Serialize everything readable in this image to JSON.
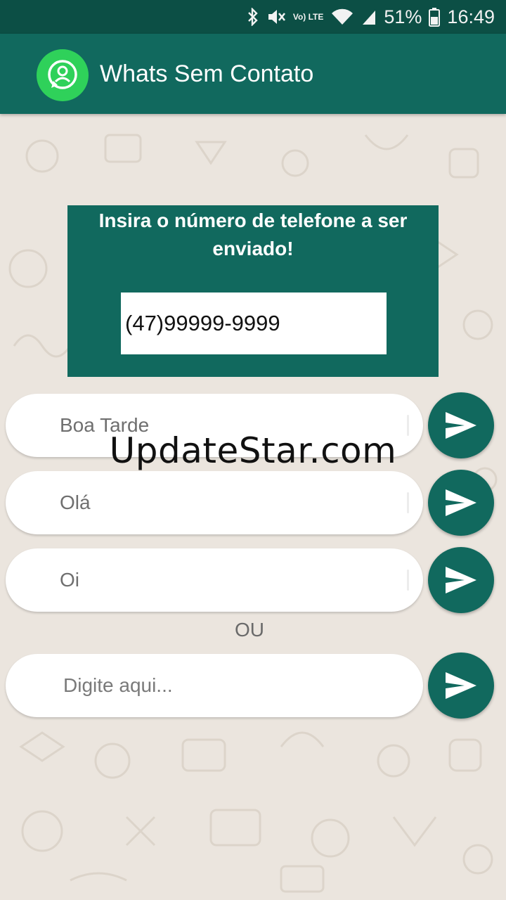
{
  "status_bar": {
    "battery_percent": "51%",
    "time": "16:49",
    "network_label": "Vo) LTE"
  },
  "app_bar": {
    "title": "Whats Sem Contato"
  },
  "phone_card": {
    "title": "Insira o número de telefone a ser enviado!",
    "phone_value": "(47)99999-9999"
  },
  "messages": [
    {
      "text": "Boa Tarde"
    },
    {
      "text": "Olá"
    },
    {
      "text": "Oi"
    }
  ],
  "separator": "OU",
  "custom_message": {
    "placeholder": "Digite aqui..."
  },
  "watermark": "UpdateStar.com",
  "colors": {
    "status_bar": "#0c4f45",
    "app_bar": "#11695e",
    "logo": "#2fd15a",
    "background": "#ebe5de"
  }
}
